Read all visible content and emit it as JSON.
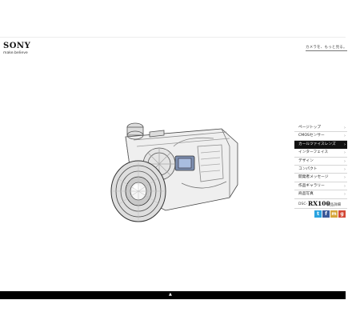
{
  "header": {
    "brand": "SONY",
    "tagline": "make.believe",
    "top_link": "カメラを、もっと見る。"
  },
  "menu": {
    "items": [
      {
        "label": "ページトップ",
        "active": false
      },
      {
        "label": "CMOSセンサー",
        "active": false
      },
      {
        "label": "カールツァイスレンズ",
        "active": true
      },
      {
        "label": "インターフェイス",
        "active": false
      },
      {
        "label": "デザイン",
        "active": false
      },
      {
        "label": "コンパクト",
        "active": false
      },
      {
        "label": "開発者メッセージ",
        "active": false
      },
      {
        "label": "作品ギャラリー",
        "active": false
      },
      {
        "label": "商品写真",
        "active": false
      }
    ],
    "arrow_glyph": "›"
  },
  "model": {
    "prefix": "DSC-",
    "name": "RX100",
    "link": "製品詳細"
  },
  "social": [
    {
      "icon": "twitter-icon",
      "glyph": "t",
      "color": "#2aa3e0"
    },
    {
      "icon": "facebook-icon",
      "glyph": "f",
      "color": "#3b5a9a"
    },
    {
      "icon": "mixi-icon",
      "glyph": "m",
      "color": "#d6a63c"
    },
    {
      "icon": "google-plus-icon",
      "glyph": "g",
      "color": "#d34836"
    }
  ],
  "footer": {
    "arrow_glyph": "▲"
  },
  "colors": {
    "active_bg": "#111111",
    "bottom_bar": "#000000"
  }
}
